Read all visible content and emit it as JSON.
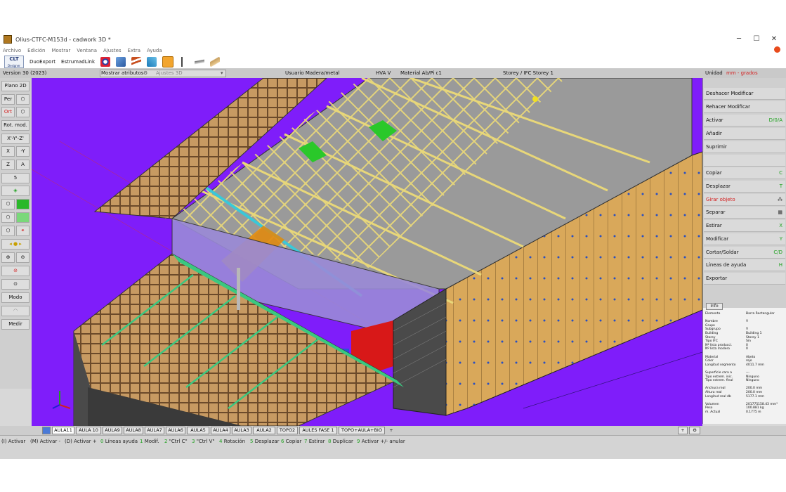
{
  "window": {
    "title": "Olius-CTFC-M153d - cadwork 3D *",
    "minimize": "─",
    "maximize": "☐",
    "close": "✕"
  },
  "menu": [
    "Archivo",
    "Edición",
    "Mostrar",
    "Ventana",
    "Ajustes",
    "Extra",
    "Ayuda"
  ],
  "ribbon": {
    "clt_line1": "CLT",
    "clt_line2": "Designer",
    "duoexport": "DuoExport",
    "estrumad": "EstrumadLink",
    "icons": [
      "globe-tool-icon",
      "csv-export-icon",
      "stairs-icon",
      "connector-icon",
      "briefcase-icon",
      "gallows-icon",
      "roof-icon",
      "beam-icon"
    ]
  },
  "status": {
    "version": "Version 30 (2023)",
    "mostrar": "Mostrar atributos",
    "ajustes": "Ajustes 3D",
    "usuario": "Usuario  Madera/metal",
    "hva": "HVA  V",
    "material": "Material  Ab/Pi c1",
    "storey": "Storey / IFC  Storey 1",
    "unidad": "Unidad",
    "unidad_value": "mm - grados"
  },
  "left_toolbar": {
    "plano": "Plano 2D",
    "per": "Per",
    "orth": "Ort",
    "rot": "Rot. mod.",
    "xyz": "X'-Y'-Z'",
    "x": "X",
    "neg_y": "-Y",
    "z": "Z",
    "a": "A",
    "five": "5",
    "modo": "Modo",
    "medir": "Medir"
  },
  "right_panel": [
    {
      "label": "Deshacer Modificar",
      "shortcut": ""
    },
    {
      "label": "Rehacer Modificar",
      "shortcut": ""
    },
    {
      "label": "Activar",
      "shortcut": "D/0/A"
    },
    {
      "label": "Añadir",
      "shortcut": ""
    },
    {
      "label": "Suprimir",
      "shortcut": ""
    },
    {
      "label": "",
      "shortcut": ""
    },
    {
      "label": "Copiar",
      "shortcut": "C"
    },
    {
      "label": "Desplazar",
      "shortcut": "T"
    },
    {
      "label": "Girar objeto",
      "shortcut": ""
    },
    {
      "label": "Separar",
      "shortcut": ""
    },
    {
      "label": "Estirar",
      "shortcut": "X"
    },
    {
      "label": "Modificar",
      "shortcut": "Y"
    },
    {
      "label": "Cortar/Soldar",
      "shortcut": "C/D"
    },
    {
      "label": "Líneas de ayuda",
      "shortcut": "H"
    },
    {
      "label": "Exportar",
      "shortcut": ""
    }
  ],
  "info": {
    "tab": "Info",
    "rows": [
      [
        "Elemento",
        "Barra Rectangular"
      ],
      [
        "",
        ""
      ],
      [
        "Nombre",
        "V"
      ],
      [
        "Grupo",
        ""
      ],
      [
        "Subgrupo",
        "V"
      ],
      [
        "Building",
        "Building 1"
      ],
      [
        "Storey",
        "Storey 1"
      ],
      [
        "Tipo IFC",
        "Sin"
      ],
      [
        "Nº lista producci.",
        "0"
      ],
      [
        "Nº lista modero",
        "0"
      ],
      [
        "",
        ""
      ],
      [
        "Material",
        "Abeto"
      ],
      [
        "Color",
        "rojo"
      ],
      [
        "Longitud segmento",
        "4011.7 mm"
      ],
      [
        "",
        ""
      ],
      [
        "Superficie cara a",
        "---"
      ],
      [
        "Tipo extrem. inic.",
        "Ninguno"
      ],
      [
        "Tipo extrem. final",
        "Ninguno"
      ],
      [
        "",
        ""
      ],
      [
        "Anchura real",
        "200.0 mm"
      ],
      [
        "Altura real",
        "200.0 mm"
      ],
      [
        "Longitud real db",
        "5177.1 mm"
      ],
      [
        "",
        ""
      ],
      [
        "Volumen",
        "201775158.43 mm³"
      ],
      [
        "Peso",
        "100.881 kg"
      ],
      [
        "m. Actual",
        "0.1775 m"
      ]
    ]
  },
  "tabs": [
    "AULA11",
    "AULA 10",
    "AULA9",
    "AULA8",
    "AULA7",
    "AULA6",
    "AULA5",
    "AULA4",
    "AULA3",
    "AULA2",
    "TOPO2",
    "AULES FASE 1",
    "TOPO+AULA+BIO"
  ],
  "tabs_add": "+",
  "hints": [
    {
      "key": "",
      "text": "(I) Activar"
    },
    {
      "key": "",
      "text": "(M) Activar -"
    },
    {
      "key": "",
      "text": "(D) Activar +"
    },
    {
      "key": "0",
      "text": "Líneas ayuda"
    },
    {
      "key": "1",
      "text": "Modif."
    },
    {
      "key": "2",
      "text": "\"Ctrl C\""
    },
    {
      "key": "3",
      "text": "\"Ctrl V\""
    },
    {
      "key": "4",
      "text": "Rotación"
    },
    {
      "key": "5",
      "text": "Desplazar"
    },
    {
      "key": "6",
      "text": "Copiar"
    },
    {
      "key": "7",
      "text": "Estirar"
    },
    {
      "key": "8",
      "text": "Duplicar"
    },
    {
      "key": "9",
      "text": "Activar +/- anular"
    }
  ],
  "colors": {
    "viewport": "#7f1dfa",
    "wall": "#d9a85a",
    "truss": "#e8d779",
    "shortcut": "#1fa11f"
  }
}
